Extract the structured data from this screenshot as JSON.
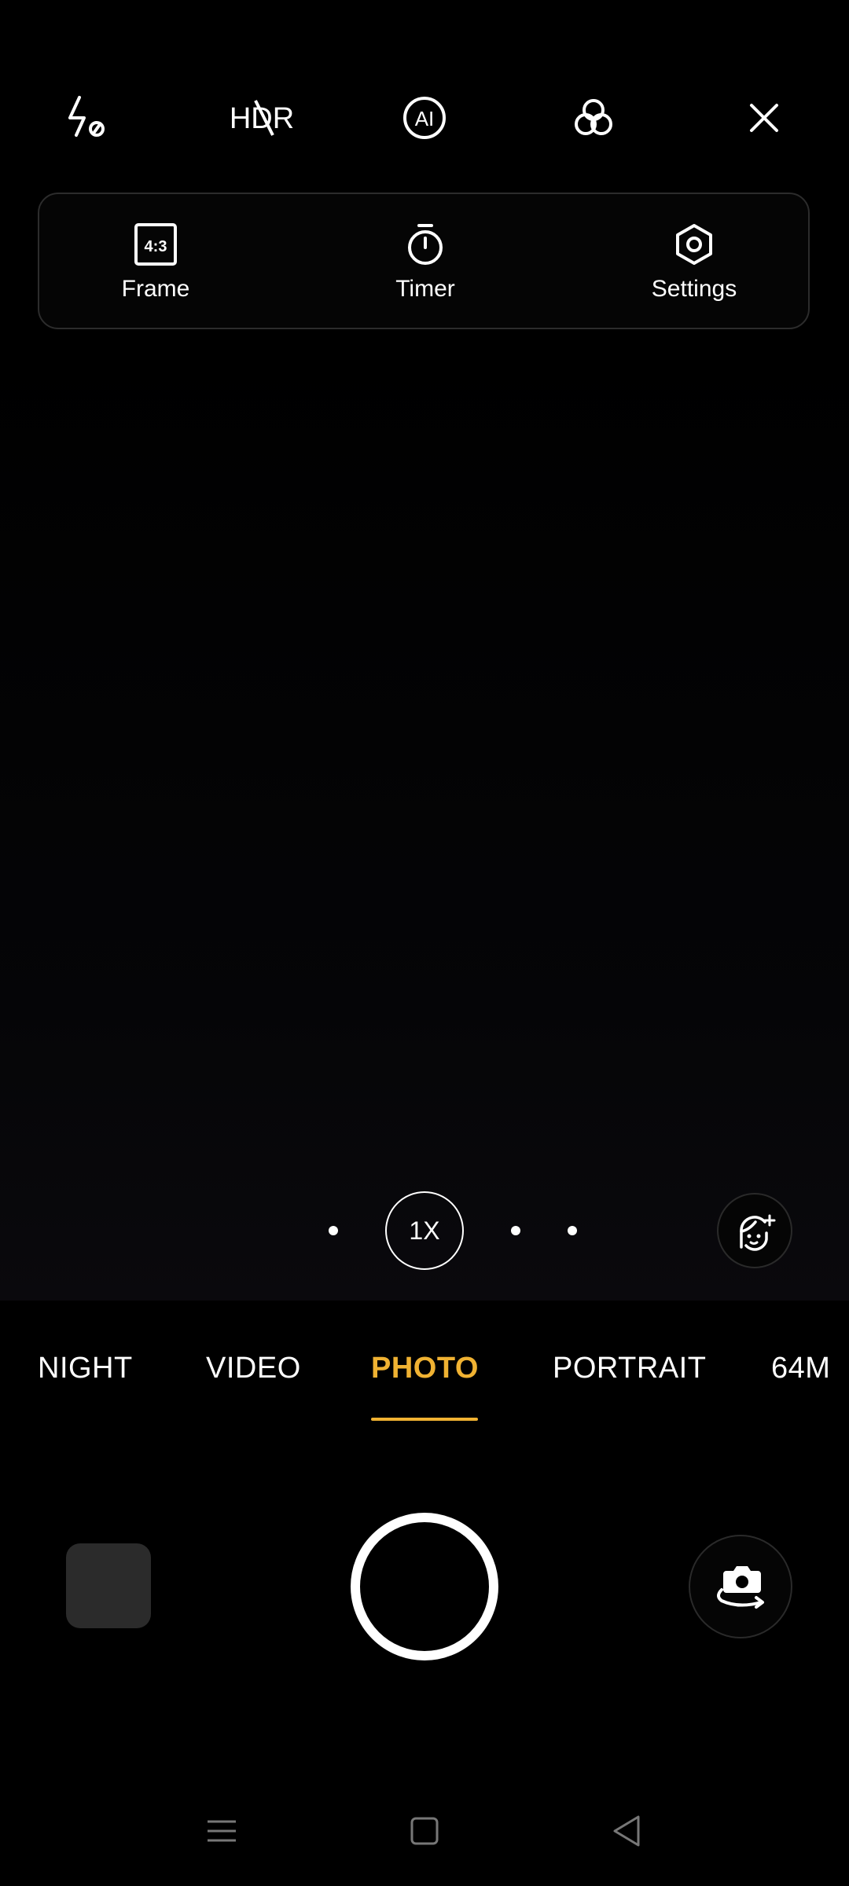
{
  "top_bar": {
    "icons": {
      "flash": "flash-off-icon",
      "hdr": "hdr-off-icon",
      "ai": "ai-icon",
      "filters": "filters-icon",
      "close": "close-icon"
    },
    "hdr_text": "HDR",
    "ai_text": "AI"
  },
  "quick_panel": {
    "frame": {
      "label": "Frame",
      "icon": "aspect-ratio-icon",
      "icon_text": "4:3"
    },
    "timer": {
      "label": "Timer",
      "icon": "timer-icon"
    },
    "settings": {
      "label": "Settings",
      "icon": "settings-icon"
    }
  },
  "zoom": {
    "current": "1X",
    "beauty_icon": "beauty-face-icon"
  },
  "modes": {
    "items": [
      "NIGHT",
      "VIDEO",
      "PHOTO",
      "PORTRAIT",
      "64M"
    ],
    "active": "PHOTO"
  },
  "controls": {
    "shutter_icon": "shutter-icon",
    "flip_icon": "flip-camera-icon"
  },
  "colors": {
    "accent": "#f0b232",
    "background": "#000000",
    "thumbnail": "#2b2b2b"
  },
  "nav": {
    "recents": "recents-icon",
    "home": "home-icon",
    "back": "back-icon"
  }
}
